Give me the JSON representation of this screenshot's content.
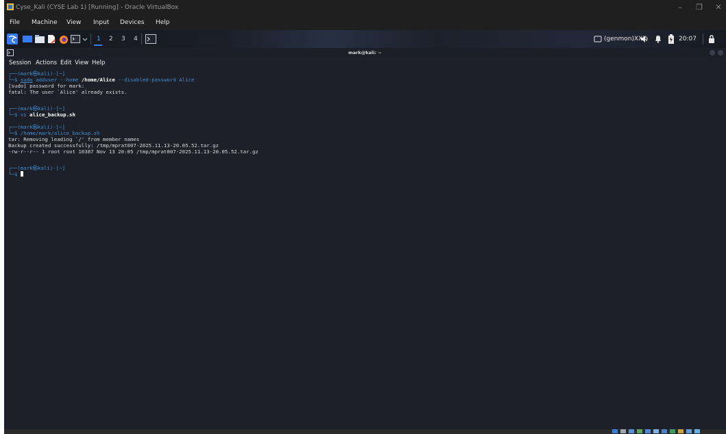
{
  "window": {
    "title": "Cyse_Kali (CYSE Lab 1) [Running] - Oracle VirtualBox",
    "minimize": "–",
    "restore": "❐",
    "close": "✕"
  },
  "menubar": {
    "items": [
      "File",
      "Machine",
      "View",
      "Input",
      "Devices",
      "Help"
    ]
  },
  "panel": {
    "workspaces": [
      "1",
      "2",
      "3",
      "4"
    ],
    "genmon": "(genmon)XXX",
    "clock": "20:07",
    "colors": {
      "kali_blue": "#367bf0",
      "accent": "#3f8ed1"
    }
  },
  "terminal": {
    "title": "mark@kali: ~",
    "menu": [
      "Session",
      "Actions",
      "Edit",
      "View",
      "Help"
    ],
    "lines": {
      "p1_user": "┌──(mark㉿kali)-[~]",
      "c1_prompt": "└─$ ",
      "c1_sudo": "sudo",
      "c1_adduser": " adduser --home ",
      "c1_path": "/home/Alice",
      "c1_rest": " --disabled-password Alice",
      "o1": "[sudo] password for mark:",
      "o2": "fatal: The user `Alice' already exists.",
      "p2_user": "┌──(mark㉿kali)-[~]",
      "c2_prompt": "└─$ ",
      "c2_vi": "vi ",
      "c2_file": "alice_backup.sh",
      "p3_user": "┌──(mark㉿kali)-[~]",
      "c3_prompt": "└─$ ",
      "c3_cmd": "/home/mark/alice_backup.sh",
      "o3": "tar: Removing leading `/' from member names",
      "o4": "Backup created successfully: /tmp/mprat007-2025.11.13-20.05.52.tar.gz",
      "o5": "-rw-r--r-- 1 root root 10387 Nov 13 20:05 /tmp/mprat007-2025.11.13-20.05.52.tar.gz",
      "p4_user": "┌──(mark㉿kali)-[~]",
      "c4_prompt": "└─$ "
    }
  }
}
